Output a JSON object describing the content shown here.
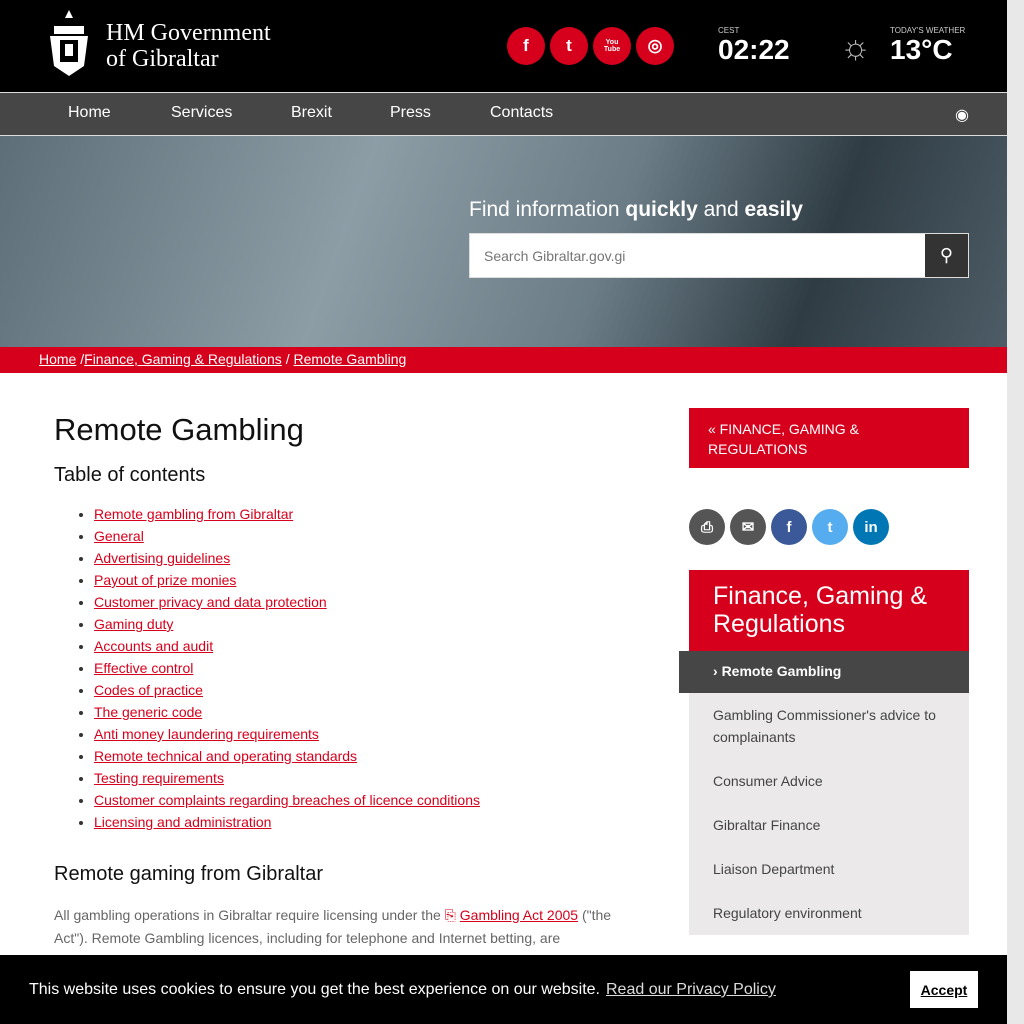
{
  "header": {
    "logo_line1": "HM Government",
    "logo_line2": "of Gibraltar",
    "social": [
      "f",
      "t",
      "You Tube",
      "ig"
    ],
    "tz": "CEST",
    "time": "02:22",
    "weather_label": "TODAY'S WEATHER",
    "temp": "13°C"
  },
  "nav": [
    "Home",
    "Services",
    "Brexit",
    "Press",
    "Contacts"
  ],
  "hero": {
    "title_pre": "Find information ",
    "title_b1": "quickly",
    "title_mid": " and ",
    "title_b2": "easily",
    "search_placeholder": "Search Gibraltar.gov.gi"
  },
  "breadcrumb": [
    "Home",
    "Finance, Gaming & Regulations",
    "Remote Gambling"
  ],
  "main": {
    "title": "Remote Gambling",
    "toc_title": "Table of contents",
    "toc": [
      "Remote gambling from Gibraltar",
      "General",
      "Advertising guidelines",
      "Payout of prize monies",
      "Customer privacy and data protection",
      "Gaming duty",
      "Accounts and audit",
      "Effective control",
      "Codes of practice",
      "The generic code",
      "Anti money laundering requirements",
      "Remote technical and operating standards",
      "Testing requirements",
      "Customer complaints regarding breaches of licence conditions",
      "Licensing and administration"
    ],
    "section_title": "Remote gaming from Gibraltar",
    "para_pre": "All gambling operations in Gibraltar require licensing under the ",
    "para_link": "Gambling Act 2005",
    "para_post": " (\"the Act\"). Remote Gambling licences, including for telephone and Internet betting, are"
  },
  "side": {
    "back": "« FINANCE, GAMING & REGULATIONS",
    "menu_title": "Finance, Gaming & Regulations",
    "active": "Remote Gambling",
    "items": [
      "Gambling Commissioner's advice to complainants",
      "Consumer Advice",
      "Gibraltar Finance",
      "Liaison Department",
      "Regulatory environment"
    ]
  },
  "cookie": {
    "text": "This website uses cookies to ensure you get the best experience on our website.",
    "link": "Read our Privacy Policy",
    "accept": "Accept"
  }
}
